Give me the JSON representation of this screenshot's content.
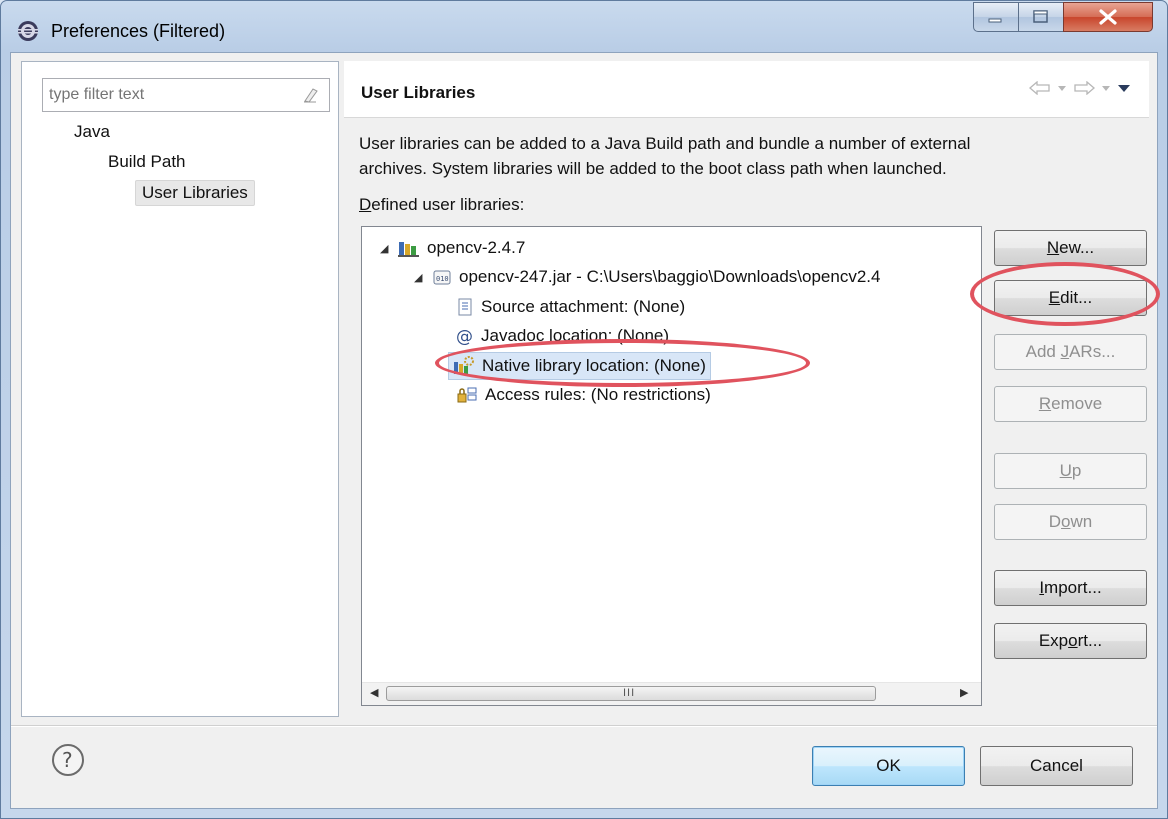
{
  "window": {
    "title": "Preferences (Filtered)"
  },
  "filter": {
    "placeholder": "type filter text"
  },
  "nav_tree": [
    {
      "label": "Java"
    },
    {
      "label": "Build Path"
    },
    {
      "label": "User Libraries"
    }
  ],
  "page": {
    "title": "User Libraries",
    "description_line1": "User libraries can be added to a Java Build path and bundle a number of external",
    "description_line2": "archives. System libraries will be added to the boot class path when launched.",
    "defined_label_prefix": "D",
    "defined_label_rest": "efined user libraries:"
  },
  "library_tree": {
    "library": "opencv-2.4.7",
    "jar": "opencv-247.jar - C:\\Users\\baggio\\Downloads\\opencv2.4",
    "children": [
      "Source attachment: (None)",
      "Javadoc location: (None)",
      "Native library location: (None)",
      "Access rules: (No restrictions)"
    ],
    "scroll_grip": "III"
  },
  "buttons": {
    "new": {
      "mn": "N",
      "rest": "ew..."
    },
    "edit": {
      "mn": "E",
      "rest": "dit..."
    },
    "add_jars": {
      "pre": "Add ",
      "mn": "J",
      "rest": "ARs..."
    },
    "remove": {
      "mn": "R",
      "rest": "emove"
    },
    "up": {
      "mn": "U",
      "rest": "p"
    },
    "down": {
      "pre": "D",
      "mn": "o",
      "rest": "wn"
    },
    "import": {
      "mn": "I",
      "rest": "mport..."
    },
    "export": {
      "pre": "Exp",
      "mn": "o",
      "rest": "rt..."
    },
    "ok": "OK",
    "cancel": "Cancel"
  },
  "annotation_color": "#e0535e"
}
